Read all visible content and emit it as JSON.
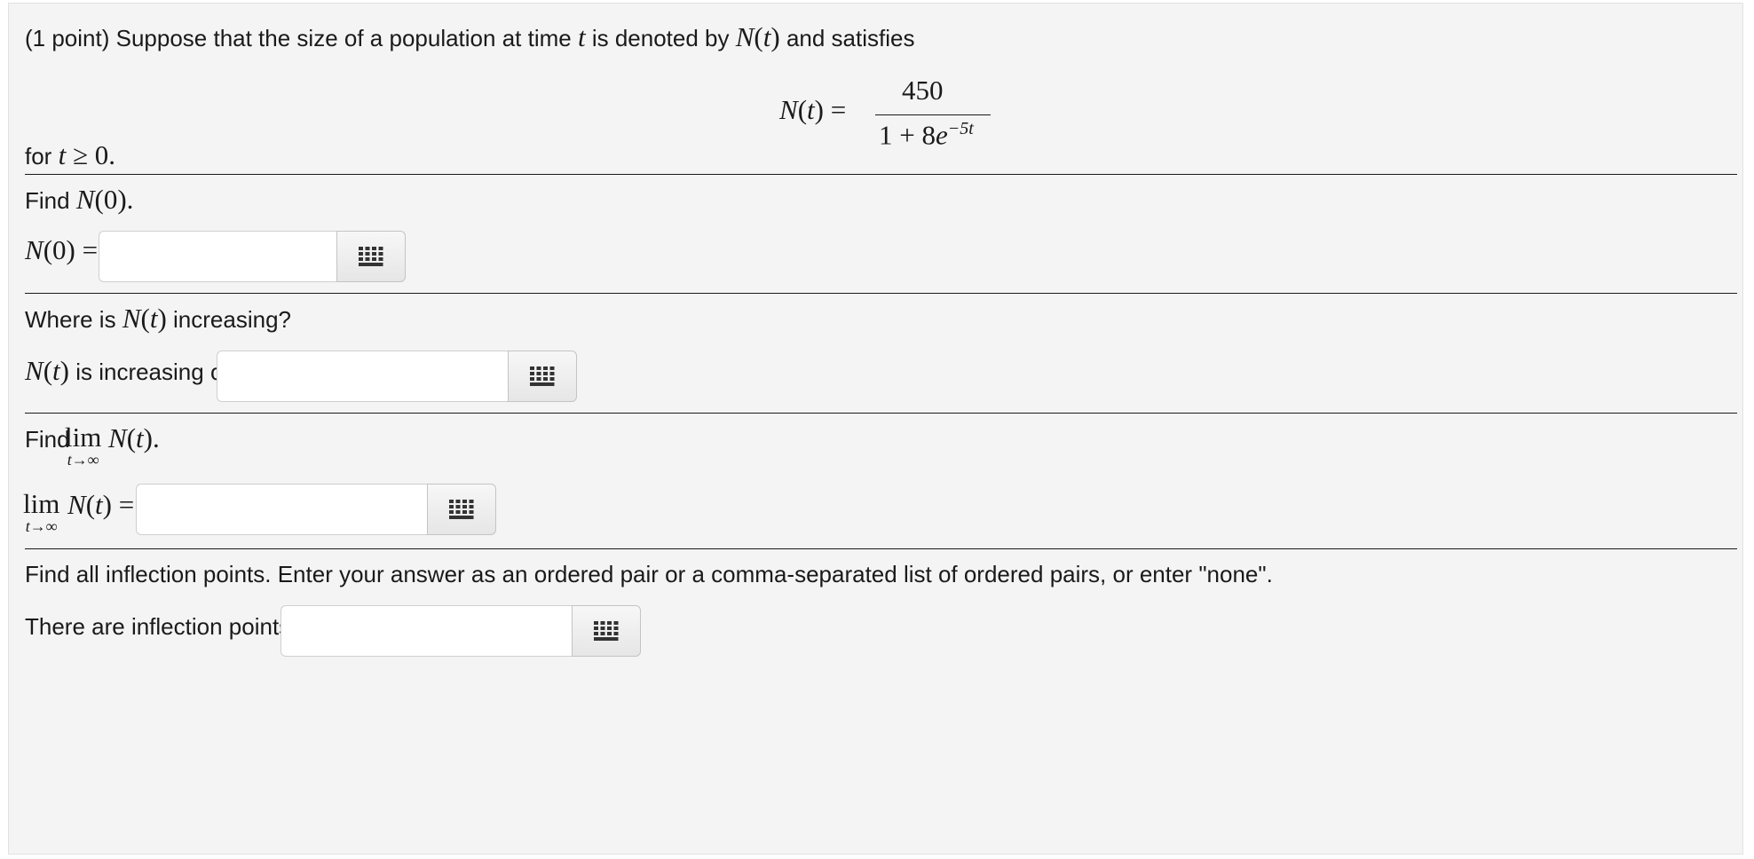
{
  "problem": {
    "intro_a": "(1 point) Suppose that the size of a population at time",
    "var_t": "t",
    "intro_b": "is denoted by",
    "N_of_t": "N(t)",
    "intro_c": "and satisfies",
    "formula_lhs": "N(t) =",
    "formula_num": "450",
    "formula_den_a": "1 + 8",
    "formula_den_e": "e",
    "formula_den_exp": "−5t",
    "domain_a": "for",
    "domain_cond": "t ≥ 0."
  },
  "parts": [
    {
      "prompt_a": "Find",
      "prompt_math": "N(0).",
      "label_math": "N(0) =",
      "input_value": ""
    },
    {
      "prompt_a": "Where is",
      "prompt_math": "N(t)",
      "prompt_b": "increasing?",
      "label_math": "N(t)",
      "label_text": "is increasing on",
      "input_value": ""
    },
    {
      "prompt_a": "Find",
      "lim_word": "lim",
      "lim_sub": "t→∞",
      "prompt_math": "N(t).",
      "label_lim_word": "lim",
      "label_lim_sub": "t→∞",
      "label_math": "N(t) =",
      "input_value": ""
    },
    {
      "prompt": "Find all inflection points. Enter your answer as an ordered pair or a comma-separated list of ordered pairs, or enter \"none\".",
      "label_text": "There are inflection points at",
      "input_value": ""
    }
  ],
  "icons": {
    "keyboard": "keypad-grid-icon"
  },
  "colors": {
    "panel_bg": "#f4f4f4",
    "rule": "#1a1a1a",
    "input_border": "#cfcfcf"
  }
}
